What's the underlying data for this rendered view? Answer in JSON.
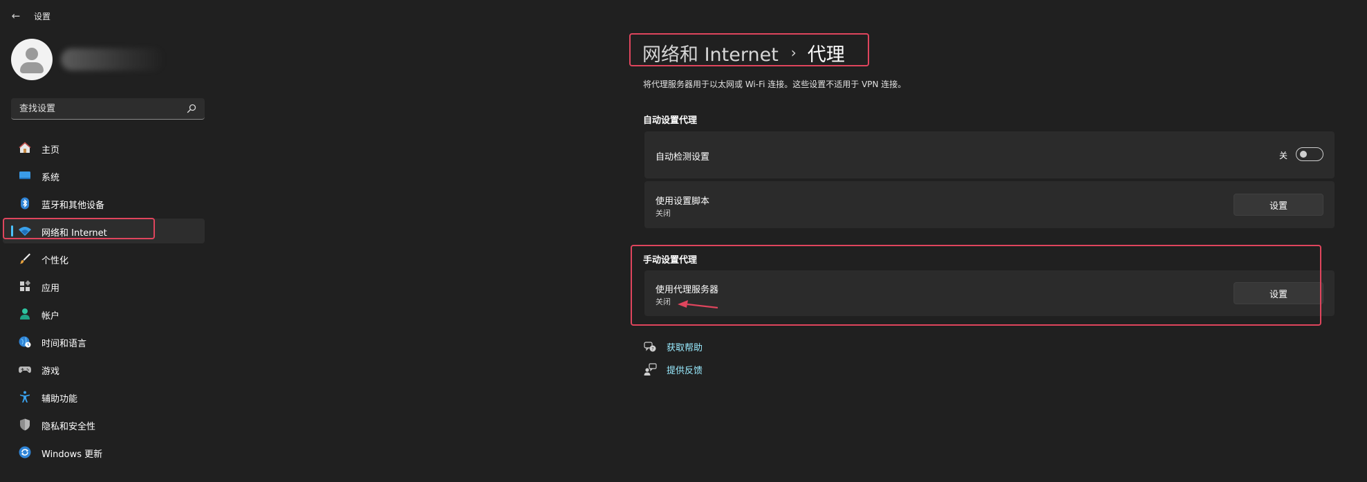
{
  "window": {
    "title": "设置",
    "back_glyph": "←"
  },
  "search": {
    "placeholder": "查找设置"
  },
  "sidebar": {
    "items": [
      {
        "label": "主页",
        "icon": "home-icon"
      },
      {
        "label": "系统",
        "icon": "system-icon"
      },
      {
        "label": "蓝牙和其他设备",
        "icon": "bluetooth-icon"
      },
      {
        "label": "网络和 Internet",
        "icon": "wifi-icon",
        "active": true
      },
      {
        "label": "个性化",
        "icon": "brush-icon"
      },
      {
        "label": "应用",
        "icon": "apps-icon"
      },
      {
        "label": "帐户",
        "icon": "account-icon"
      },
      {
        "label": "时间和语言",
        "icon": "time-language-icon"
      },
      {
        "label": "游戏",
        "icon": "gamepad-icon"
      },
      {
        "label": "辅助功能",
        "icon": "accessibility-icon"
      },
      {
        "label": "隐私和安全性",
        "icon": "shield-icon"
      },
      {
        "label": "Windows 更新",
        "icon": "update-icon"
      }
    ]
  },
  "header": {
    "breadcrumb_parent": "网络和 Internet",
    "breadcrumb_separator": "›",
    "breadcrumb_current": "代理"
  },
  "main": {
    "description": "将代理服务器用于以太网或 Wi-Fi 连接。这些设置不适用于 VPN 连接。",
    "auto_section": {
      "title": "自动设置代理",
      "detect": {
        "label": "自动检测设置",
        "toggle_state_label": "关",
        "toggle_on": false
      },
      "script": {
        "label": "使用设置脚本",
        "status": "关闭",
        "button": "设置"
      }
    },
    "manual_section": {
      "title": "手动设置代理",
      "proxy": {
        "label": "使用代理服务器",
        "status": "关闭",
        "button": "设置"
      }
    },
    "links": {
      "help": "获取帮助",
      "feedback": "提供反馈"
    }
  },
  "colors": {
    "background": "#202020",
    "card": "#2b2b2b",
    "accent": "#4cc2ff",
    "link": "#99ebff",
    "highlight": "#e0455d"
  }
}
